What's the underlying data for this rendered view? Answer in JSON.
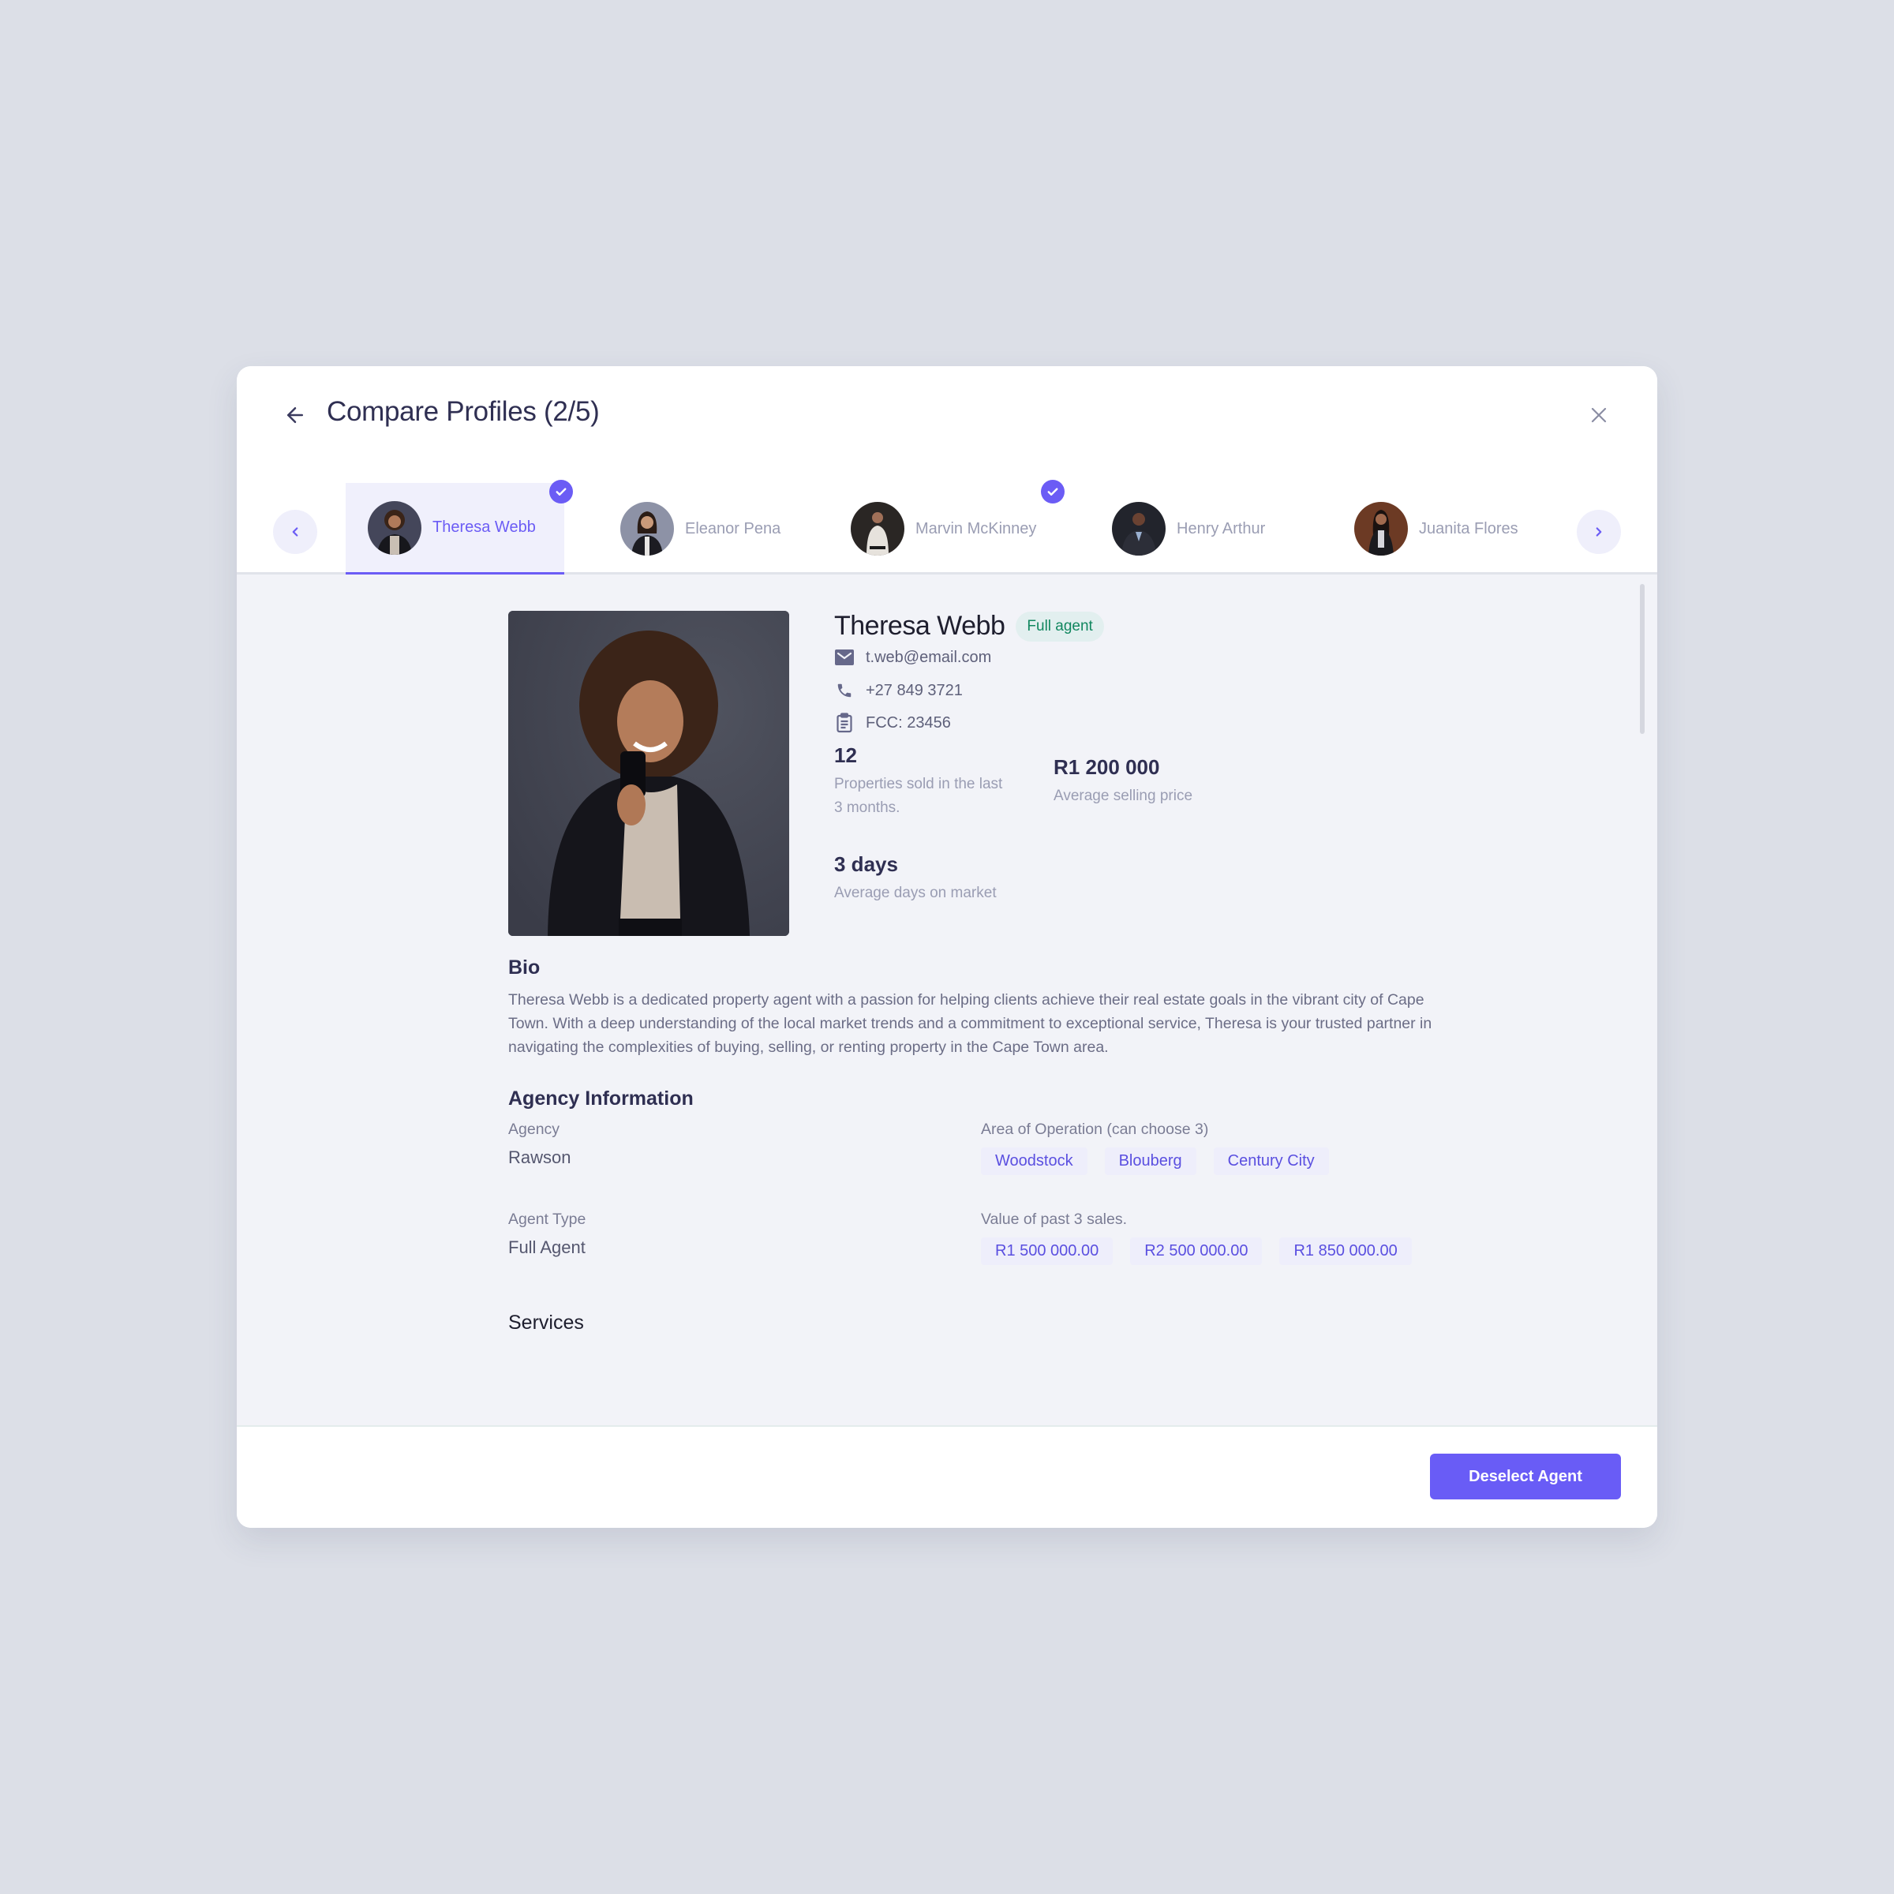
{
  "header": {
    "title": "Compare Profiles (2/5)",
    "back_icon": "arrow-left-icon",
    "close_icon": "close-icon"
  },
  "tabs": [
    {
      "name": "Theresa Webb",
      "active": true,
      "checked": true,
      "avatar_colors": [
        "#3a3c48",
        "#5a3a2a"
      ]
    },
    {
      "name": "Eleanor Pena",
      "active": false,
      "checked": false,
      "avatar_colors": [
        "#8a8fa3",
        "#3a2a22"
      ]
    },
    {
      "name": "Marvin McKinney",
      "active": false,
      "checked": true,
      "avatar_colors": [
        "#2a2624",
        "#e8e4df"
      ]
    },
    {
      "name": "Henry Arthur",
      "active": false,
      "checked": false,
      "avatar_colors": [
        "#22242c",
        "#4a3a30"
      ]
    },
    {
      "name": "Juanita Flores",
      "active": false,
      "checked": false,
      "avatar_colors": [
        "#6a3a26",
        "#1a1a1e"
      ]
    }
  ],
  "colors": {
    "accent": "#6b5cf5",
    "badge_green": "#11875f",
    "badge_bg": "#e2efef"
  },
  "profile": {
    "name": "Theresa Webb",
    "badge": "Full agent",
    "email": "t.web@email.com",
    "phone": "+27 849 3721",
    "fcc": "FCC: 23456",
    "stats": {
      "properties_sold": {
        "value": "12",
        "label_line1": "Properties sold in the last",
        "label_line2": "3 months."
      },
      "avg_price": {
        "value": "R1 200 000",
        "label": "Average selling price"
      },
      "avg_days": {
        "value": "3 days",
        "label": "Average days on market"
      }
    }
  },
  "bio": {
    "title": "Bio",
    "text": "Theresa Webb is a dedicated property agent with a passion for helping clients achieve their real estate goals in the vibrant city of Cape Town. With a deep understanding of the local market trends and a commitment to exceptional service, Theresa is your trusted partner in navigating the complexities of buying, selling, or renting property in the Cape Town area."
  },
  "agency": {
    "title": "Agency Information",
    "agency_label": "Agency",
    "agency_value": "Rawson",
    "type_label": "Agent Type",
    "type_value": "Full Agent",
    "area_label": "Area of Operation (can choose 3)",
    "areas": [
      "Woodstock",
      "Blouberg",
      "Century City"
    ],
    "sales_label": "Value of past 3 sales.",
    "sales": [
      "R1 500 000.00",
      "R2 500 000.00",
      "R1 850 000.00"
    ]
  },
  "services": {
    "title": "Services"
  },
  "footer": {
    "deselect_label": "Deselect Agent"
  }
}
